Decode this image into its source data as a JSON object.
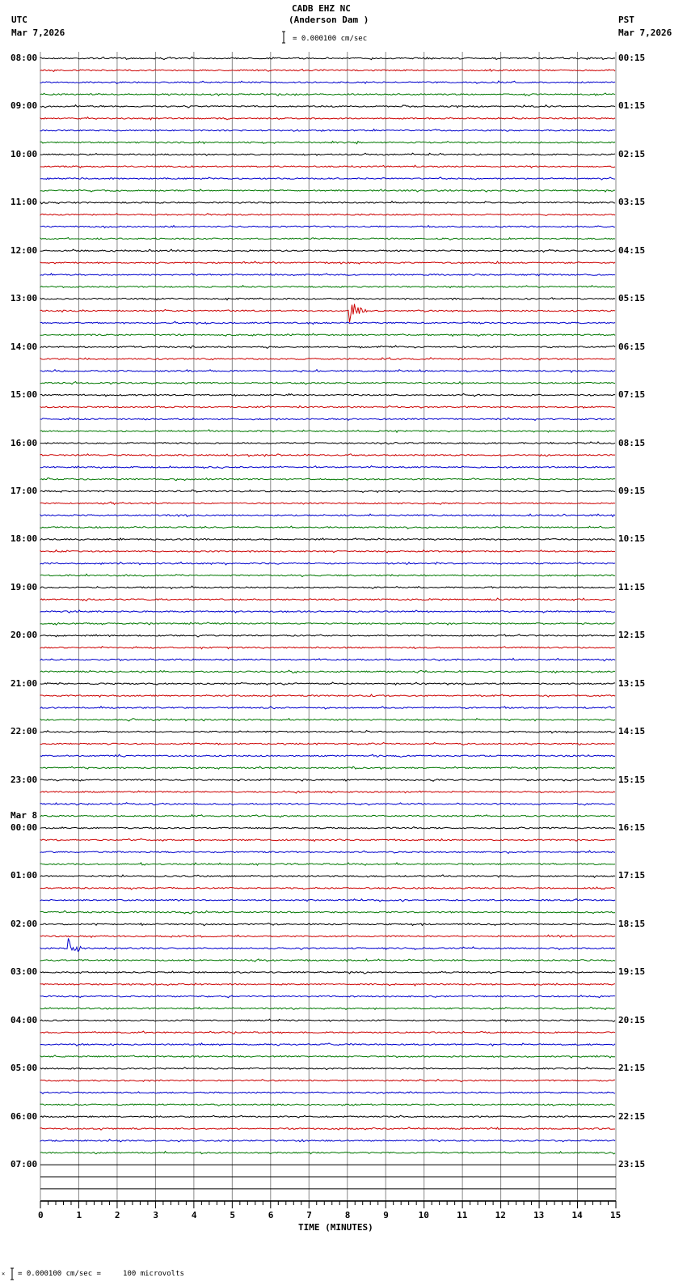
{
  "header": {
    "station": "CADB EHZ NC",
    "location": "(Anderson Dam )",
    "left_tz": "UTC",
    "left_date": "Mar 7,2026",
    "right_tz": "PST",
    "right_date": "Mar 7,2026",
    "scale": "= 0.000100 cm/sec"
  },
  "footer": {
    "scale": "= 0.000100 cm/sec =     100 microvolts",
    "mark": "×"
  },
  "chart_data": {
    "type": "line",
    "title": "CADB EHZ NC (Anderson Dam )",
    "xlabel": "TIME (MINUTES)",
    "xlim": [
      0,
      15
    ],
    "xticks": [
      "0",
      "1",
      "2",
      "3",
      "4",
      "5",
      "6",
      "7",
      "8",
      "9",
      "10",
      "11",
      "12",
      "13",
      "14",
      "15"
    ],
    "traces_per_hour": 4,
    "trace_colors": [
      "#000000",
      "#cc0000",
      "#0000cc",
      "#007700"
    ],
    "left_labels": [
      "08:00",
      "09:00",
      "10:00",
      "11:00",
      "12:00",
      "13:00",
      "14:00",
      "15:00",
      "16:00",
      "17:00",
      "18:00",
      "19:00",
      "20:00",
      "21:00",
      "22:00",
      "23:00",
      "00:00",
      "01:00",
      "02:00",
      "03:00",
      "04:00",
      "05:00",
      "06:00",
      "07:00"
    ],
    "date_change_label": "Mar 8",
    "right_labels": [
      "00:15",
      "01:15",
      "02:15",
      "03:15",
      "04:15",
      "05:15",
      "06:15",
      "07:15",
      "08:15",
      "09:15",
      "10:15",
      "11:15",
      "12:15",
      "13:15",
      "14:15",
      "15:15",
      "16:15",
      "17:15",
      "18:15",
      "19:15",
      "20:15",
      "21:15",
      "22:15",
      "23:15"
    ],
    "traces_with_data": 92,
    "total_traces": 96,
    "events": [
      {
        "trace_utc": "13:15",
        "minute": 8.05,
        "amplitude": 3.0
      },
      {
        "trace_utc": "02:30",
        "minute": 0.7,
        "amplitude": 2.4
      },
      {
        "trace_utc": "09:00",
        "minute": 9.4,
        "amplitude": 0.3
      }
    ]
  }
}
